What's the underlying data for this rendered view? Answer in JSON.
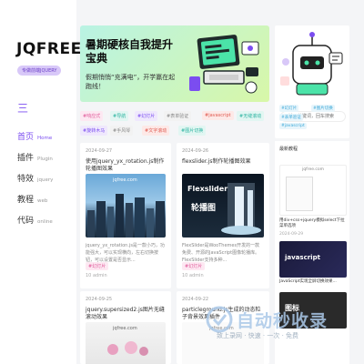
{
  "sidebar": {
    "logo": "JQFREE",
    "badge": "专做前端JQUERY",
    "menu_icon": "三",
    "nav": [
      {
        "zh": "首页",
        "en": "Home",
        "active": true
      },
      {
        "zh": "插件",
        "en": "Plugin",
        "active": false
      },
      {
        "zh": "特效",
        "en": "jquery",
        "active": false
      },
      {
        "zh": "教程",
        "en": "web",
        "active": false
      },
      {
        "zh": "代码",
        "en": "online",
        "active": false
      }
    ]
  },
  "banner": {
    "title": "暑期硬核自我提升宝典",
    "subtitle": "假期悄悄“充满电”，开学赢在起跑线！"
  },
  "tags": [
    {
      "label": "#响应式",
      "color": "#e05a9a",
      "bg": "#fde8f2"
    },
    {
      "label": "#导航",
      "color": "#2bb3a0",
      "bg": "#e2f6f2"
    },
    {
      "label": "#幻灯片",
      "color": "#7b4df0",
      "bg": "#efe8fd"
    },
    {
      "label": "#表单验证",
      "color": "#888",
      "bg": "#f2f2f2"
    },
    {
      "label": "#javascript",
      "color": "#e05a50",
      "bg": "#fde9e7"
    },
    {
      "label": "#无缝滚动",
      "color": "#2bb3a0",
      "bg": "#e2f6f2"
    },
    {
      "label": "#旋转木马",
      "color": "#7b4df0",
      "bg": "#efe8fd"
    },
    {
      "label": "#手风琴",
      "color": "#888",
      "bg": "#f2f2f2"
    },
    {
      "label": "#文字滚动",
      "color": "#e05a50",
      "bg": "#fde9e7"
    },
    {
      "label": "#图片切换",
      "color": "#2bb3a0",
      "bg": "#e2f6f2"
    }
  ],
  "search": {
    "placeholder": "输入关键词，回车搜索"
  },
  "right_tags": [
    "#幻灯片",
    "#图片切换",
    "#表单验证",
    "#javascript"
  ],
  "cards": [
    {
      "date": "2024-09-27",
      "title": "使用jquery_yx_rotation.js制作轮播图效果",
      "img_caption": "jqfree.com",
      "desc": "jquery_yx_rotation.js是一款小巧，功能强大，可以实现横向，左右切换按钮，可以设置是否显示...",
      "tag": "#幻灯片",
      "meta": "10  admin"
    },
    {
      "date": "2024-09-26",
      "title": "flexslider.js制作轮播图效果",
      "img_caption": "Flexslider",
      "img_sub": "轮播图",
      "desc": "FlexSlider是WooThemes开发的一款免费、开源的JavaScript图像轮播库。FlexSlider支持多种...",
      "tag": "#幻灯片",
      "meta": "10  admin"
    },
    {
      "date": "2024-09-25",
      "title": "jquery.supersized2.js图片无缝滚动效果",
      "img_caption": "jqfree.com"
    },
    {
      "date": "2024-09-22",
      "title": "particleground.js生成的动态粒子背景效果插件",
      "img_caption": "jqfree.com"
    }
  ],
  "right_list": {
    "head": "最新教程",
    "items": [
      {
        "img_caption": "jqfree.com",
        "title": "用div+css+jquery模拟select下拉菜单选项",
        "date": "2024-09-29"
      },
      {
        "img_caption": "javascript",
        "title": "JavaScript实现全屏切换效果...",
        "date": ""
      },
      {
        "img_caption": "图标",
        "title": "",
        "date": ""
      }
    ]
  },
  "watermark": {
    "main": "自动秒收录",
    "sub": "致上录网 · 快速 · 一次 · 免费"
  }
}
